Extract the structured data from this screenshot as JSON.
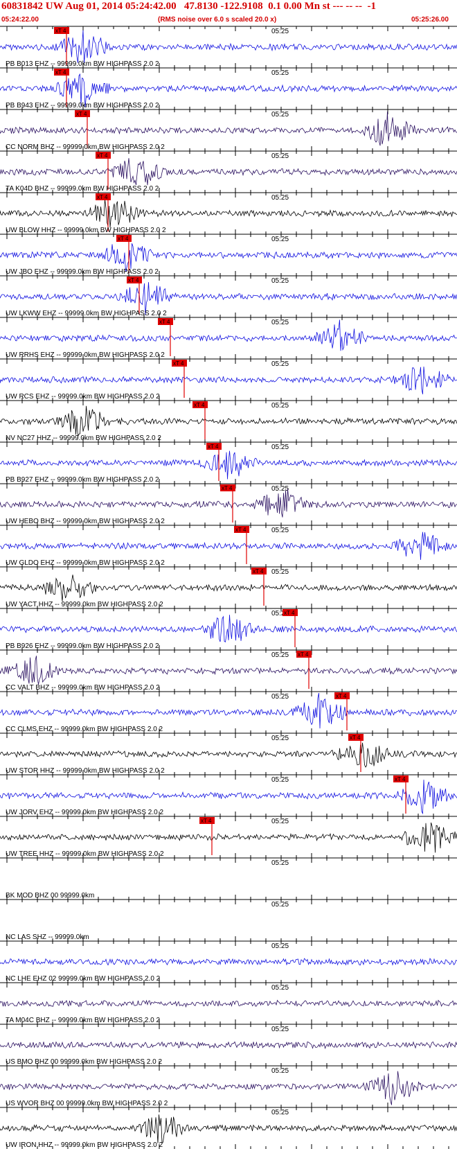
{
  "header": {
    "title": "60831842 UW Aug 01, 2014 05:24:42.00   47.8130 -122.9108  0.1 0.00 Mn st --- -- --  -1",
    "start_time": "05:24:22.00",
    "note": "(RMS noise over 6.0 s scaled 20.0 x)",
    "end_time": "05:25:26.00"
  },
  "time_mark_label": "05:25",
  "pick_label": "xT 4",
  "colors": {
    "header": "#d40000",
    "pick": "#e00000",
    "grid": "#000000",
    "blue": "#1010e0",
    "navy": "#2a1060",
    "black": "#000000"
  },
  "channels": [
    {
      "label": "PB B013 EHZ -- 99999.0km BW  HIGHPASS  2.0  2",
      "color": "blue",
      "pick": true,
      "burst_at": 0.18
    },
    {
      "label": "PB B943 EHZ -- 99999.0km BW  HIGHPASS  2.0  2",
      "color": "blue",
      "pick": true,
      "burst_at": 0.18
    },
    {
      "label": "CC NORM BHZ -- 99999.0km BW  HIGHPASS  2.0  2",
      "color": "navy",
      "pick": true,
      "burst_at": 0.85
    },
    {
      "label": "TA K04D BHZ -- 99999.0km BW  HIGHPASS  2.0  2",
      "color": "navy",
      "pick": true,
      "burst_at": 0.3
    },
    {
      "label": "UW BLOW HHZ -- 99999.0km BW  HIGHPASS  2.0  2",
      "color": "black",
      "pick": true,
      "burst_at": 0.25
    },
    {
      "label": "UW JBO EHZ -- 99999.0km BW  HIGHPASS  2.0  2",
      "color": "blue",
      "pick": true,
      "burst_at": 0.28
    },
    {
      "label": "UW LKWW EHZ -- 99999.0km BW  HIGHPASS  2.0  2",
      "color": "blue",
      "pick": true,
      "burst_at": 0.32
    },
    {
      "label": "UW RRHS EHZ -- 99999.0km BW  HIGHPASS  2.0  2",
      "color": "blue",
      "pick": true,
      "burst_at": 0.75
    },
    {
      "label": "UW RCS EHZ -- 99999.0km BW  HIGHPASS  2.0  2",
      "color": "blue",
      "pick": true,
      "burst_at": 0.92
    },
    {
      "label": "NV NC27 HHZ -- 99999.0km BW  HIGHPASS  2.0  2",
      "color": "black",
      "pick": true,
      "burst_at": 0.18
    },
    {
      "label": "PB B927 EHZ -- 99999.0km BW  HIGHPASS  2.0  2",
      "color": "blue",
      "pick": true,
      "burst_at": 0.5
    },
    {
      "label": "UW HEBO BHZ -- 99999.0km BW  HIGHPASS  2.0  2",
      "color": "navy",
      "pick": true,
      "burst_at": 0.62
    },
    {
      "label": "UW GLDO EHZ -- 99999.0km BW  HIGHPASS  2.0  2",
      "color": "blue",
      "pick": true,
      "burst_at": 0.92
    },
    {
      "label": "UW YACT HHZ -- 99999.0km BW  HIGHPASS  2.0  2",
      "color": "black",
      "pick": true,
      "burst_at": 0.15
    },
    {
      "label": "PB B926 EHZ -- 99999.0km BW  HIGHPASS  2.0  2",
      "color": "blue",
      "pick": true,
      "burst_at": 0.5
    },
    {
      "label": "CC VALT BHZ -- 99999.0km BW  HIGHPASS  2.0  2",
      "color": "navy",
      "pick": true,
      "burst_at": 0.07
    },
    {
      "label": "CC CLMS EHZ -- 99999.0km BW  HIGHPASS  2.0  2",
      "color": "blue",
      "pick": true,
      "burst_at": 0.7
    },
    {
      "label": "UW STOR HHZ -- 99999.0km BW  HIGHPASS  2.0  2",
      "color": "black",
      "pick": true,
      "burst_at": 0.79
    },
    {
      "label": "UW JORV EHZ -- 99999.0km BW  HIGHPASS  2.0  2",
      "color": "blue",
      "pick": true,
      "burst_at": 0.93
    },
    {
      "label": "UW TREE HHZ -- 99999.0km BW  HIGHPASS  2.0  2",
      "color": "black",
      "pick": true,
      "burst_at": 0.94
    },
    {
      "label": "BK MOD BHZ 00 99999.0km",
      "color": "none",
      "pick": false,
      "burst_at": 0
    },
    {
      "label": "NC LAS SHZ -- 99999.0km",
      "color": "none",
      "pick": false,
      "burst_at": 0
    },
    {
      "label": "NC LHE EHZ 02 99999.0km BW  HIGHPASS  2.0  2",
      "color": "blue",
      "pick": false,
      "burst_at": 0
    },
    {
      "label": "TA M04C BHZ -- 99999.0km BW  HIGHPASS  2.0  2",
      "color": "navy",
      "pick": false,
      "burst_at": 0
    },
    {
      "label": "US BMO BHZ 00 99999.0km BW  HIGHPASS  2.0  2",
      "color": "navy",
      "pick": false,
      "burst_at": 0
    },
    {
      "label": "US WVOR BHZ 00 99999.0km BW  HIGHPASS  2.0  2",
      "color": "navy",
      "pick": false,
      "burst_at": 0.86
    },
    {
      "label": "UW IRON HHZ -- 99999.0km BW  HIGHPASS  2.0  2",
      "color": "black",
      "pick": false,
      "burst_at": 0.35
    }
  ]
}
